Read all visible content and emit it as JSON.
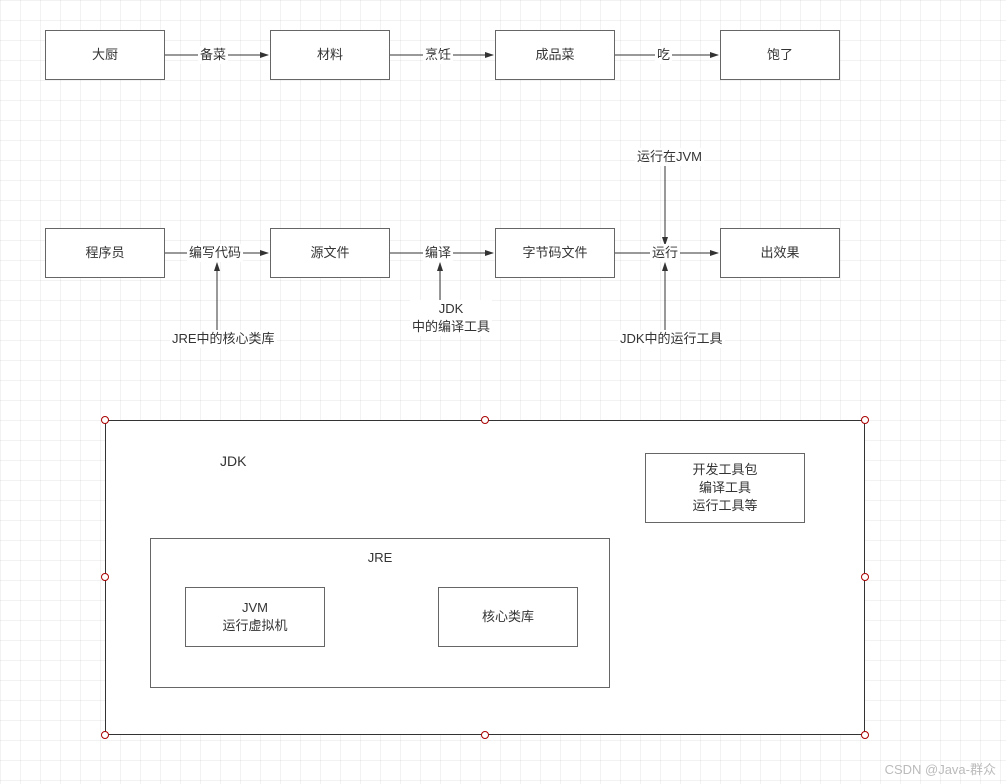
{
  "row1": {
    "box1": "大厨",
    "box2": "材料",
    "box3": "成品菜",
    "box4": "饱了",
    "arrow1": "备菜",
    "arrow2": "烹饪",
    "arrow3": "吃"
  },
  "row2": {
    "box1": "程序员",
    "box2": "源文件",
    "box3": "字节码文件",
    "box4": "出效果",
    "arrow1": "编写代码",
    "arrow2": "编译",
    "arrow3": "运行",
    "top_annotation": "运行在JVM",
    "jre_annotation": "JRE中的核心类库",
    "jdk_compile_annotation": "JDK\n中的编译工具",
    "jdk_run_annotation": "JDK中的运行工具"
  },
  "container": {
    "jdk_label": "JDK",
    "jre_label": "JRE",
    "jvm_label": "JVM\n运行虚拟机",
    "core_lib_label": "核心类库",
    "dev_tools_label": "开发工具包\n编译工具\n运行工具等"
  },
  "watermark": "CSDN @Java-群众"
}
